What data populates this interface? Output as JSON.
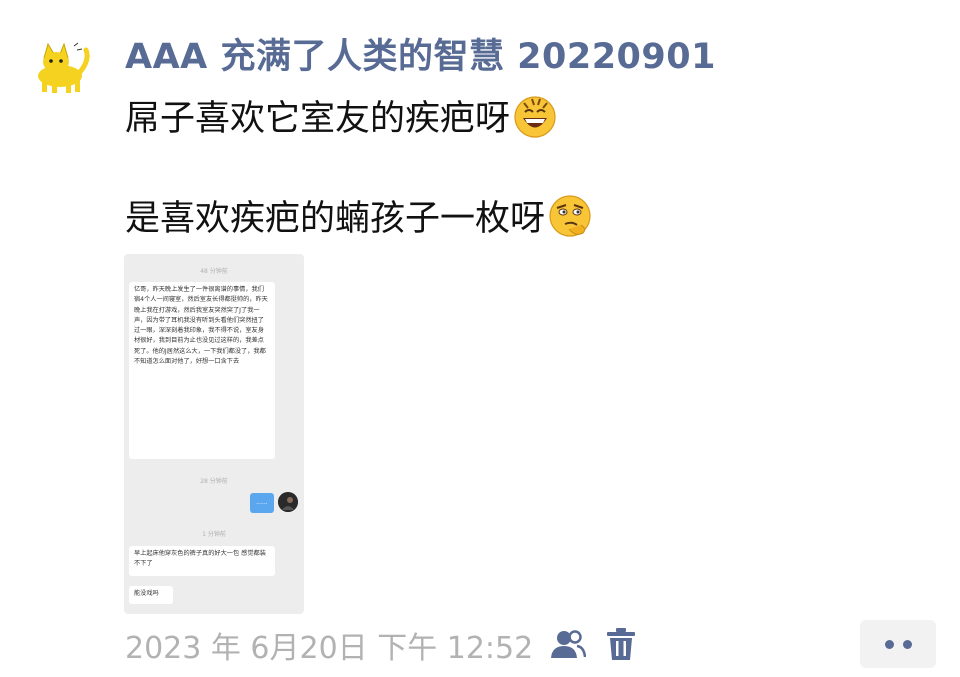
{
  "post": {
    "author": "AAA 充满了人类的智慧 20220901",
    "line1": "屌子喜欢它室友的疾疤呀",
    "line1_emoji": "grinning-sweat-emoji",
    "line2": "是喜欢疾疤的蝻孩子一枚呀",
    "line2_emoji": "thinking-emoji",
    "timestamp": "2023 年 6月20日 下午 12:52"
  },
  "thumbnail": {
    "time1": "48 分钟前",
    "message1": "亿哥，昨天晚上发生了一件很离谱的事情，我们宿4个人一间寝室，然后室友长得都挺帅的，昨天晚上我在打游戏，然后我室友突然突了J了我一声，因为带了耳机我没有听到头看他们突然扭了过一眼，深深刻着我印象，我不得不说，室友身材很好，我到目前为止也没见过这样的，我差点死了。他的J居然这么大，一下我们都没了，我都不知道怎么面对他了，好想一口含下去",
    "time2": "28 分钟前",
    "bubble_right": "......",
    "time3": "1 分钟前",
    "message2": "早上起床他穿灰色的裤子真的好大一包 感觉都装不下了",
    "message3": "能没戏吗"
  },
  "actions": {
    "friends_icon": "friends-icon",
    "delete_icon": "trash-icon",
    "more_icon": "more-dots-icon"
  },
  "colors": {
    "link_blue": "#576b95",
    "timestamp_gray": "#b2b2b2"
  }
}
